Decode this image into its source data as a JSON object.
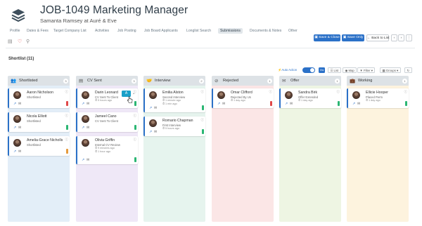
{
  "header": {
    "title": "JOB-1049 Marketing Manager",
    "subtitle": "Samanta Ramsey at Auré & Eve",
    "logo_icon": "stacked-layers-icon"
  },
  "tabs": [
    {
      "label": "Profile",
      "active": false
    },
    {
      "label": "Dates & Fees",
      "active": false
    },
    {
      "label": "Target Company List",
      "active": false
    },
    {
      "label": "Activities",
      "active": false
    },
    {
      "label": "Job Posting",
      "active": false
    },
    {
      "label": "Job Board Applicants",
      "active": false
    },
    {
      "label": "Longlist Search",
      "active": false
    },
    {
      "label": "Submissions",
      "active": true
    },
    {
      "label": "Documents & Notes",
      "active": false
    },
    {
      "label": "Other",
      "active": false
    }
  ],
  "actions": {
    "save_close": "Save & Close",
    "save_only": "Save Only",
    "back_to_list": "Back to List",
    "prev": "‹",
    "next": "›",
    "menu": "⋮"
  },
  "section_title": "Shortlist (11)",
  "controls": {
    "auto_action": "Auto Action",
    "toggle_on": true,
    "list": "List",
    "map": "Map",
    "filter": "Filter",
    "groups": "Groups",
    "view_label": "Vw"
  },
  "colors": {
    "accent": "#2b71c8",
    "hover_tag": "#1aa0c8",
    "green": "#2bb673",
    "red": "#e04848",
    "orange": "#e59a3c"
  },
  "columns": [
    {
      "title": "Shortlisted",
      "icon": "users-icon",
      "count": "3",
      "bg": "#e3eef8",
      "cards": [
        {
          "name": "Aaron Nicholson",
          "status": "Shortlisted",
          "line3": "",
          "line4": "",
          "flag": "#e04848",
          "height": 28
        },
        {
          "name": "Nicola Elliott",
          "status": "Shortlisted",
          "line3": "",
          "line4": "",
          "flag": "#2bb673",
          "height": 28
        },
        {
          "name": "Amelia-Grace Nicholls",
          "status": "Shortlisted",
          "line3": "",
          "line4": "",
          "flag": "#e59a3c",
          "height": 28
        }
      ]
    },
    {
      "title": "CV Sent",
      "icon": "file-icon",
      "count": "3",
      "bg": "#efe8f7",
      "cards": [
        {
          "name": "Darin Leonard",
          "status": "CV Sent To Client",
          "line3": "⏱ 5 hours ago",
          "line4": "",
          "flag": "#2bb673",
          "height": 28
        },
        {
          "name": "Jameel Cano",
          "status": "CV Sent To Client",
          "line3": "",
          "line4": "",
          "flag": "#2bb673",
          "height": 28
        },
        {
          "name": "Olivia Griffin",
          "status": "Internal CV Review",
          "line3": "⏱ 9 minutes ago",
          "line4": "⏱ 1 hour ago",
          "flag": "#2bb673",
          "height": 40
        }
      ]
    },
    {
      "title": "Interview",
      "icon": "handshake-icon",
      "count": "2",
      "bg": "#e6f4ee",
      "cards": [
        {
          "name": "Emilia Alston",
          "status": "Second Interview",
          "line3": "⏱ 1 minute ago",
          "line4": "⏱ 1 min ago",
          "flag": "#2bb673",
          "height": 34
        },
        {
          "name": "Romario Chapman",
          "status": "First Interview",
          "line3": "⏱ 5 hours ago",
          "line4": "",
          "flag": "#2bb673",
          "height": 28
        }
      ]
    },
    {
      "title": "Rejected",
      "icon": "reject-icon",
      "count": "1",
      "bg": "#fbe6e6",
      "cards": [
        {
          "name": "Omar Clifford",
          "status": "Rejected By Us",
          "line3": "⏱ 1 day ago",
          "line4": "",
          "flag": "#e04848",
          "height": 28
        }
      ]
    },
    {
      "title": "Offer",
      "icon": "offer-icon",
      "count": "1",
      "bg": "#eef5e3",
      "cards": [
        {
          "name": "Sandra Birk",
          "status": "Offer Extended",
          "line3": "⏱ 1 day ago",
          "line4": "",
          "flag": "#2bb673",
          "height": 28
        }
      ]
    },
    {
      "title": "Working",
      "icon": "briefcase-icon",
      "count": "1",
      "bg": "#fdf3de",
      "cards": [
        {
          "name": "Ellicie Hooper",
          "status": "Placed Perm",
          "line3": "⏱ 1 day ago",
          "line4": "",
          "flag": "#2bb673",
          "height": 28
        }
      ]
    }
  ]
}
